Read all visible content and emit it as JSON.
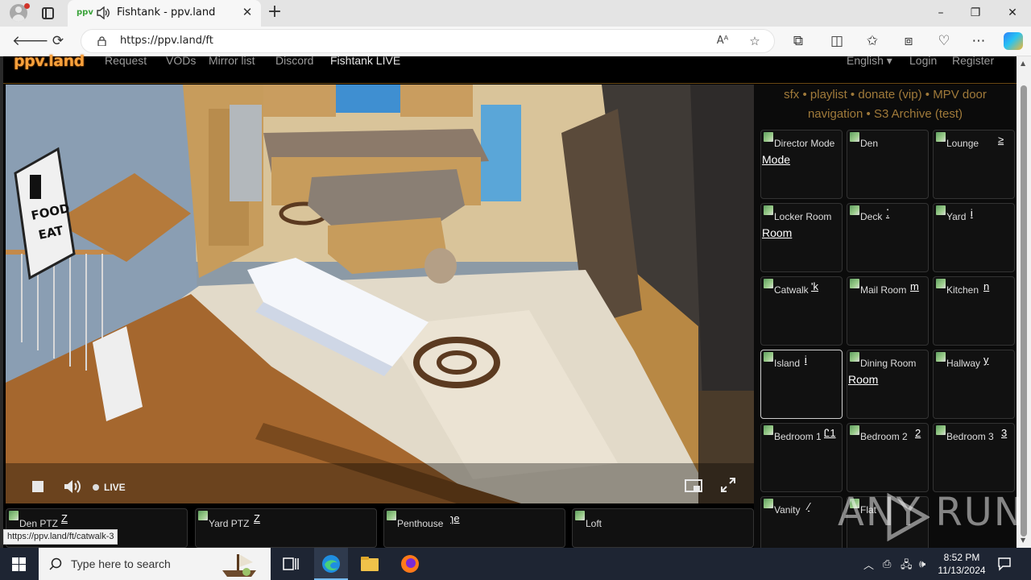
{
  "browser": {
    "tab_title": "Fishtank - ppv.land",
    "url": "https://ppv.land/ft",
    "new_tab_symbol": "+",
    "window_controls": [
      "–",
      "❐",
      "✕"
    ]
  },
  "site": {
    "logo": "ppv.land",
    "nav": [
      "Request",
      "VODs",
      "Mirror list",
      "Discord",
      "Fishtank LIVE"
    ],
    "language": "English ▾",
    "login": "Login",
    "register": "Register"
  },
  "player": {
    "live_label": "LIVE",
    "scene_labels": {
      "sign_line1": "FOOD",
      "sign_line2": "EAT"
    }
  },
  "menu": {
    "line1": [
      "sfx",
      "playlist",
      "donate (vip)",
      "MPV door"
    ],
    "line2": [
      "navigation",
      "S3 Archive (test)"
    ],
    "separator": "•"
  },
  "cameras": [
    {
      "name": "Director Mode",
      "sub": "Mode",
      "frag": ""
    },
    {
      "name": "Den",
      "sub": "",
      "frag": ""
    },
    {
      "name": "Lounge",
      "sub": "",
      "frag": "≥"
    },
    {
      "name": "Locker Room",
      "sub": "Room",
      "frag": ""
    },
    {
      "name": "Deck",
      "sub": "",
      "frag": "⁚"
    },
    {
      "name": "Yard",
      "sub": "",
      "frag": "Ꭵ"
    },
    {
      "name": "Catwalk",
      "sub": "",
      "frag": "'k"
    },
    {
      "name": "Mail Room",
      "sub": "",
      "frag": "m"
    },
    {
      "name": "Kitchen",
      "sub": "",
      "frag": "n"
    },
    {
      "name": "Island",
      "sub": "",
      "frag": "Ꭵ"
    },
    {
      "name": "Dining Room",
      "sub": "Room",
      "frag": ""
    },
    {
      "name": "Hallway",
      "sub": "",
      "frag": "y"
    },
    {
      "name": "Bedroom 1",
      "sub": "",
      "frag": "Ꮭ1"
    },
    {
      "name": "Bedroom 2",
      "sub": "",
      "frag": "2"
    },
    {
      "name": "Bedroom 3",
      "sub": "",
      "frag": "3"
    },
    {
      "name": "Vanity",
      "sub": "",
      "frag": "⁄"
    },
    {
      "name": "Flat",
      "sub": "",
      "frag": ""
    }
  ],
  "bottom_cameras": [
    {
      "name": "Den PTZ",
      "frag": "Z"
    },
    {
      "name": "Yard PTZ",
      "frag": "Z"
    },
    {
      "name": "Penthouse",
      "frag": "ɿe"
    },
    {
      "name": "Loft",
      "frag": ""
    }
  ],
  "status_url": "https://ppv.land/ft/catwalk-3",
  "watermark": "ANY  RUN",
  "taskbar": {
    "search_placeholder": "Type here to search",
    "time": "8:52 PM",
    "date": "11/13/2024"
  },
  "colors": {
    "accent": "#f7a13c",
    "menu_link": "#a07a3a",
    "taskbar": "#1e2533"
  }
}
